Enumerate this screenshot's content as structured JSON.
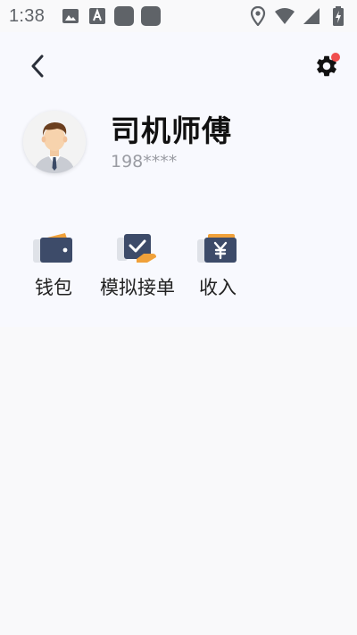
{
  "status_bar": {
    "time": "1:38",
    "icons": [
      "image-icon",
      "font-download-icon",
      "app-square-icon",
      "app-square-icon",
      "location-icon",
      "wifi-icon",
      "signal-icon",
      "battery-charging-icon"
    ]
  },
  "header": {
    "back_icon": "chevron-left-icon",
    "settings_icon": "gear-icon",
    "has_notification": true
  },
  "profile": {
    "name": "司机师傅",
    "phone": "198****"
  },
  "menu": [
    {
      "id": "wallet",
      "label": "钱包",
      "icon": "wallet-icon"
    },
    {
      "id": "mock-order",
      "label": "模拟接单",
      "icon": "order-check-icon"
    },
    {
      "id": "income",
      "label": "收入",
      "icon": "yen-icon"
    }
  ],
  "colors": {
    "icon_dark": "#3d4b69",
    "icon_accent": "#f0a13a",
    "notification": "#f04e4e",
    "header_bg": "#f8f9fe",
    "page_bg": "#f9f9fa"
  }
}
